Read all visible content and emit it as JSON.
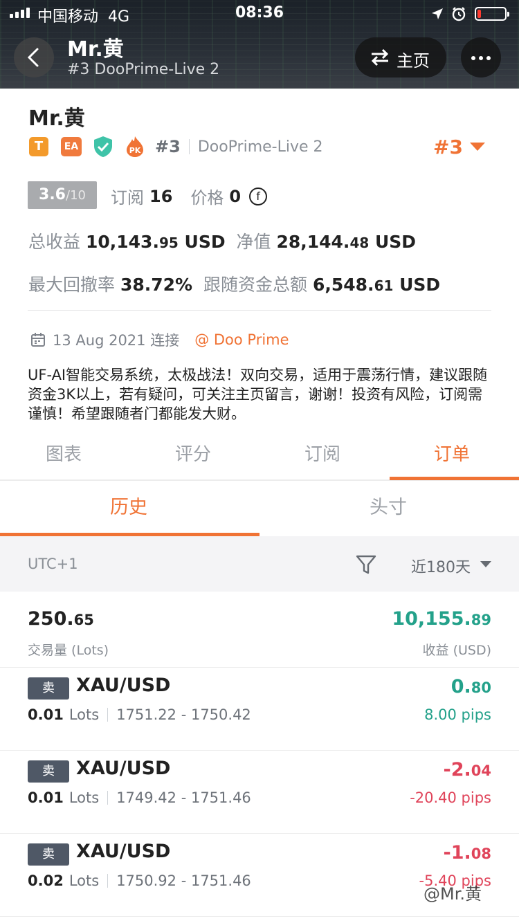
{
  "status_bar": {
    "carrier": "中国移动",
    "network": "4G",
    "time": "08:36"
  },
  "header": {
    "title": "Mr.黄",
    "subtitle": "#3 DooPrime-Live 2",
    "home_label": "主页"
  },
  "profile": {
    "name": "Mr.黄",
    "badge_t": "T",
    "badge_ea": "EA",
    "badge_pk": "PK",
    "rank": "#3",
    "server": "DooPrime-Live 2",
    "rank_big": "#3",
    "score": "3.6",
    "score_den": "/10",
    "subs_label": "订阅",
    "subs_value": "16",
    "price_label": "价格",
    "price_value": "0",
    "coin_symbol": "f",
    "total_profit_label": "总收益",
    "total_profit_int": "10,143.",
    "total_profit_dec": "95",
    "total_profit_unit": "USD",
    "equity_label": "净值",
    "equity_int": "28,144.",
    "equity_dec": "48",
    "equity_unit": "USD",
    "drawdown_label": "最大回撤率",
    "drawdown_value": "38.72%",
    "follow_label": "跟随资金总额",
    "follow_int": "6,548.",
    "follow_dec": "61",
    "follow_unit": "USD",
    "connected": "13 Aug 2021 连接",
    "broker": "@ Doo Prime",
    "description": "UF-AI智能交易系统，太极战法！双向交易，适用于震荡行情，建议跟随资金3K以上，若有疑问，可关注主页留言，谢谢！投资有风险，订阅需谨慎！希望跟随者门都能发大财。"
  },
  "tabs": [
    "图表",
    "评分",
    "订阅",
    "订单"
  ],
  "subtabs": [
    "历史",
    "头寸"
  ],
  "filter": {
    "timezone": "UTC+1",
    "period": "近180天"
  },
  "summary": {
    "lots_int": "250.",
    "lots_dec": "65",
    "lots_label": "交易量 (Lots)",
    "profit_int": "10,155.",
    "profit_dec": "89",
    "profit_label": "收益 (USD)"
  },
  "orders": [
    {
      "side": "卖",
      "symbol": "XAU/USD",
      "lots": "0.01",
      "lots_unit": "Lots",
      "range": "1751.22 - 1750.42",
      "profit_int": "0.",
      "profit_dec": "80",
      "pips": "8.00 pips"
    },
    {
      "side": "卖",
      "symbol": "XAU/USD",
      "lots": "0.01",
      "lots_unit": "Lots",
      "range": "1749.42 - 1751.46",
      "profit_int": "-2.",
      "profit_dec": "04",
      "pips": "-20.40 pips"
    },
    {
      "side": "卖",
      "symbol": "XAU/USD",
      "lots": "0.02",
      "lots_unit": "Lots",
      "range": "1750.92 - 1751.46",
      "profit_int": "-1.",
      "profit_dec": "08",
      "pips": "-5.40 pips"
    }
  ],
  "watermark": "@Mr.黄",
  "colors": {
    "accent": "#f07335",
    "positive": "#23a18a",
    "negative": "#e0445a"
  }
}
